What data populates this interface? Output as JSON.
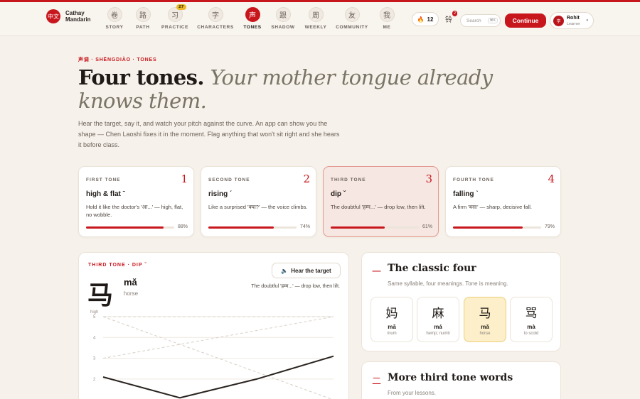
{
  "brand": {
    "seal": "中文",
    "name_line1": "Cathay",
    "name_line2": "Mandarin"
  },
  "nav": [
    {
      "glyph": "卷",
      "label": "STORY",
      "active": false
    },
    {
      "glyph": "路",
      "label": "PATH",
      "active": false
    },
    {
      "glyph": "习",
      "label": "PRACTICE",
      "active": false,
      "badge": "27"
    },
    {
      "glyph": "字",
      "label": "CHARACTERS",
      "active": false
    },
    {
      "glyph": "声",
      "label": "TONES",
      "active": true
    },
    {
      "glyph": "跟",
      "label": "SHADOW",
      "active": false
    },
    {
      "glyph": "周",
      "label": "WEEKLY",
      "active": false
    },
    {
      "glyph": "友",
      "label": "COMMUNITY",
      "active": false
    },
    {
      "glyph": "我",
      "label": "ME",
      "active": false
    }
  ],
  "header": {
    "streak_icon": "flame-icon",
    "streak_count": "12",
    "notif_icon": "铃",
    "notif_count": "2",
    "search_placeholder": "Search",
    "search_shortcut": "⌘K",
    "continue_label": "Continue",
    "user": {
      "avatar_char": "学",
      "name": "Rohit",
      "role": "Learner",
      "caret": "▾"
    }
  },
  "hero": {
    "eyebrow": "声调 · SHĒNGDIÀO · TONES",
    "headline_strong": "Four tones.",
    "headline_em": "Your mother tongue already knows them.",
    "lede": "Hear the target, say it, and watch your pitch against the curve. An app can show you the shape — Chen Laoshi fixes it in the moment. Flag anything that won't sit right and she hears it before class."
  },
  "tones": [
    {
      "label": "FIRST TONE",
      "num": "1",
      "name": "high & flat ˉ",
      "desc": "Hold it like the doctor's 'आ...' — high, flat, no wobble.",
      "progress": 0.88,
      "pct": "88%",
      "selected": false
    },
    {
      "label": "SECOND TONE",
      "num": "2",
      "name": "rising ˊ",
      "desc": "Like a surprised 'क्या?' — the voice climbs.",
      "progress": 0.74,
      "pct": "74%",
      "selected": false
    },
    {
      "label": "THIRD TONE",
      "num": "3",
      "name": "dip ˇ",
      "desc": "The doubtful 'हम्म...' — drop low, then lift.",
      "progress": 0.61,
      "pct": "61%",
      "selected": true
    },
    {
      "label": "FOURTH TONE",
      "num": "4",
      "name": "falling ˋ",
      "desc": "A firm 'बस!' — sharp, decisive fall.",
      "progress": 0.79,
      "pct": "79%",
      "selected": false
    }
  ],
  "detail": {
    "eyebrow": "THIRD TONE · DIP ˇ",
    "char": "马",
    "pinyin": "mǎ",
    "gloss": "horse",
    "hear_icon": "speaker-icon",
    "hear_label": "Hear the target",
    "note": "The doubtful 'हम्म...' — drop low, then lift.",
    "y_axis_top": "high",
    "y_ticks": [
      "5",
      "4",
      "3",
      "2"
    ]
  },
  "chart_data": {
    "type": "line",
    "ylabel": "high",
    "ylim": [
      1,
      5
    ],
    "yticks": [
      5,
      4,
      3,
      2
    ],
    "series": [
      {
        "values": [
          5,
          5
        ],
        "style": "dashed"
      },
      {
        "values": [
          3,
          5
        ],
        "style": "dashed"
      },
      {
        "values": [
          5,
          1
        ],
        "style": "dashed"
      },
      {
        "values": [
          2.1,
          1.1,
          2.0,
          3.1
        ],
        "style": "solid"
      }
    ]
  },
  "classic": {
    "mark": "一",
    "title": "The classic four",
    "subtitle": "Same syllable, four meanings. Tone is meaning.",
    "items": [
      {
        "char": "妈",
        "pinyin": "mā",
        "gloss": "mum",
        "highlight": false
      },
      {
        "char": "麻",
        "pinyin": "má",
        "gloss": "hemp; numb",
        "highlight": false
      },
      {
        "char": "马",
        "pinyin": "mǎ",
        "gloss": "horse",
        "highlight": true
      },
      {
        "char": "骂",
        "pinyin": "mà",
        "gloss": "to scold",
        "highlight": false
      }
    ]
  },
  "more": {
    "mark": "二",
    "title": "More third tone words",
    "subtitle": "From your lessons."
  }
}
